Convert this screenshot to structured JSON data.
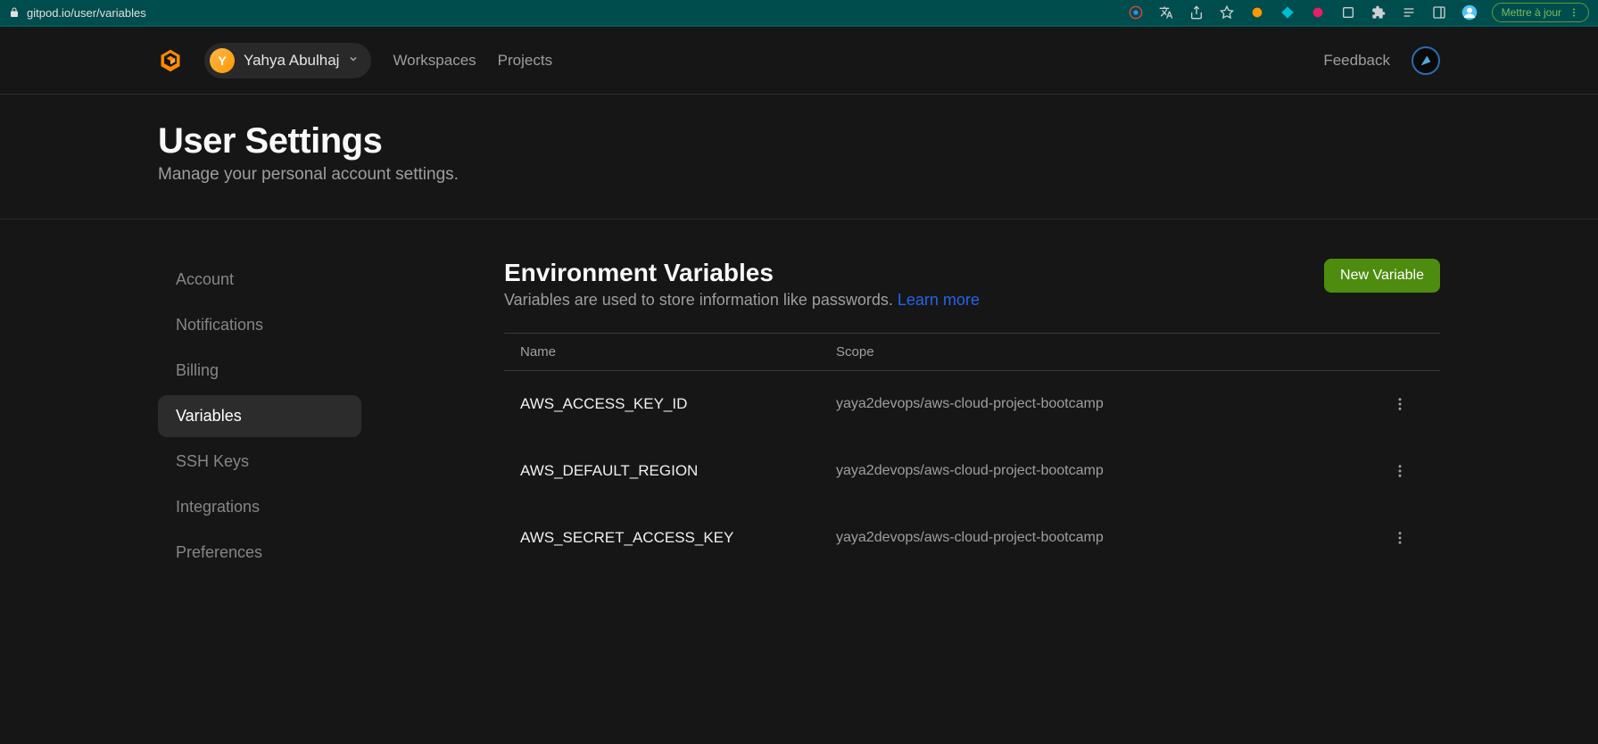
{
  "browser": {
    "url": "gitpod.io/user/variables",
    "update_label": "Mettre à jour"
  },
  "nav": {
    "user_initial": "Y",
    "user_name": "Yahya Abulhaj",
    "link_workspaces": "Workspaces",
    "link_projects": "Projects",
    "link_feedback": "Feedback"
  },
  "header": {
    "title": "User Settings",
    "subtitle": "Manage your personal account settings."
  },
  "sidebar": {
    "items": [
      {
        "label": "Account",
        "active": false
      },
      {
        "label": "Notifications",
        "active": false
      },
      {
        "label": "Billing",
        "active": false
      },
      {
        "label": "Variables",
        "active": true
      },
      {
        "label": "SSH Keys",
        "active": false
      },
      {
        "label": "Integrations",
        "active": false
      },
      {
        "label": "Preferences",
        "active": false
      }
    ]
  },
  "panel": {
    "title": "Environment Variables",
    "desc": "Variables are used to store information like passwords. ",
    "learn_more": "Learn more",
    "new_variable_btn": "New Variable",
    "table": {
      "col_name": "Name",
      "col_scope": "Scope",
      "rows": [
        {
          "name": "AWS_ACCESS_KEY_ID",
          "scope": "yaya2devops/aws-cloud-project-bootcamp"
        },
        {
          "name": "AWS_DEFAULT_REGION",
          "scope": "yaya2devops/aws-cloud-project-bootcamp"
        },
        {
          "name": "AWS_SECRET_ACCESS_KEY",
          "scope": "yaya2devops/aws-cloud-project-bootcamp"
        }
      ]
    }
  }
}
